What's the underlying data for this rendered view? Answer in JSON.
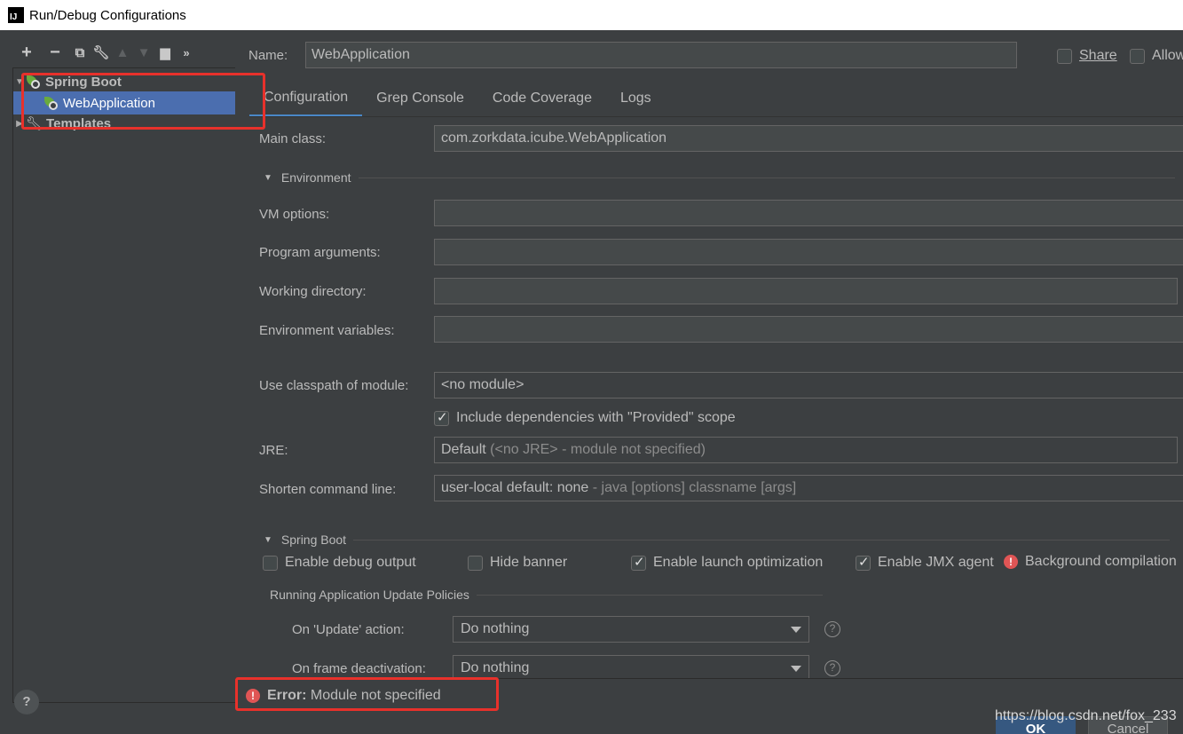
{
  "window": {
    "title": "Run/Debug Configurations"
  },
  "toolbar": {
    "icons": [
      "plus-icon",
      "minus-icon",
      "copy-icon",
      "wrench-icon",
      "arrow-up-icon",
      "arrow-down-icon",
      "folder-add-icon",
      "more-icon"
    ]
  },
  "tree": {
    "items": [
      {
        "label": "Spring Boot",
        "expanded": true
      },
      {
        "label": "WebApplication",
        "selected": true
      },
      {
        "label": "Templates",
        "expanded": false
      }
    ]
  },
  "header": {
    "name_label": "Name:",
    "name_value": "WebApplication",
    "share_label": "Share",
    "allow_label": "Allow"
  },
  "tabs": [
    "Configuration",
    "Grep Console",
    "Code Coverage",
    "Logs"
  ],
  "form": {
    "main_class_label": "Main class:",
    "main_class_value": "com.zorkdata.icube.WebApplication",
    "environment_section": "Environment",
    "vm_options_label": "VM options:",
    "program_args_label": "Program arguments:",
    "working_dir_label": "Working directory:",
    "env_vars_label": "Environment variables:",
    "classpath_label": "Use classpath of module:",
    "classpath_value": "<no module>",
    "include_deps_label": "Include dependencies with \"Provided\" scope",
    "jre_label": "JRE:",
    "jre_value": "Default",
    "jre_hint": "(<no JRE> - module not specified)",
    "shorten_label": "Shorten command line:",
    "shorten_value": "user-local default: none",
    "shorten_hint": "- java [options] classname [args]"
  },
  "spring_boot": {
    "section": "Spring Boot",
    "debug_output_label": "Enable debug output",
    "hide_banner_label": "Hide banner",
    "launch_opt_label": "Enable launch optimization",
    "jmx_label": "Enable JMX agent",
    "bg_compilation_label": "Background compilation",
    "policies_section": "Running Application Update Policies",
    "update_action_label": "On 'Update' action:",
    "update_action_value": "Do nothing",
    "frame_deact_label": "On frame deactivation:",
    "frame_deact_value": "Do nothing"
  },
  "status": {
    "error_prefix": "Error:",
    "error_message": "Module not specified"
  },
  "buttons": {
    "help": "?",
    "ok": "OK",
    "cancel": "Cancel"
  },
  "watermark": "https://blog.csdn.net/fox_233",
  "colors": {
    "accent": "#4b6eaf",
    "error": "#e05555",
    "highlight_box": "#e8312b",
    "background": "#3c3f41"
  }
}
